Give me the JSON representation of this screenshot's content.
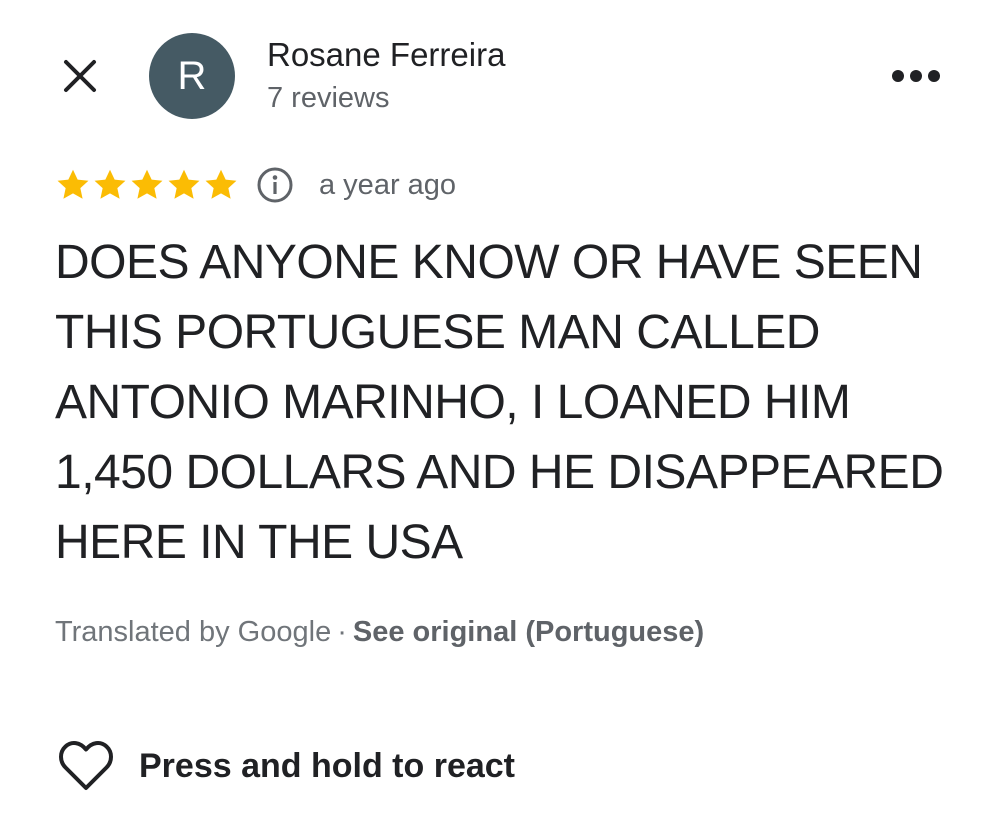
{
  "reviewer": {
    "avatar_initial": "R",
    "avatar_color": "#455a64",
    "name": "Rosane Ferreira",
    "review_count": "7 reviews"
  },
  "icons": {
    "close": "close-icon",
    "more": "more-options-icon",
    "info": "info-icon",
    "heart": "heart-outline-icon",
    "star": "star-icon"
  },
  "review": {
    "rating": 5,
    "rating_max": 5,
    "star_color": "#fbbc04",
    "date": "a year ago",
    "text": "DOES ANYONE KNOW OR HAVE SEEN THIS PORTUGUESE MAN CALLED ANTONIO MARINHO, I LOANED HIM 1,450 DOLLARS AND HE DISAPPEARED HERE IN THE USA"
  },
  "translation": {
    "label": "Translated by Google",
    "separator": "·",
    "see_original": "See original (Portuguese)"
  },
  "react": {
    "label": "Press and hold to react"
  }
}
